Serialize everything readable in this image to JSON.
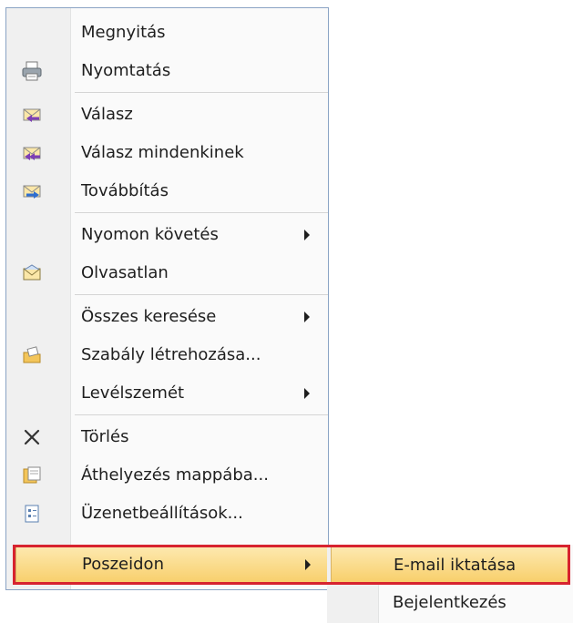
{
  "menu": {
    "items": [
      {
        "label": "Megnyitás",
        "icon": null,
        "arrow": false
      },
      {
        "label": "Nyomtatás",
        "icon": "printer-icon",
        "arrow": false
      },
      {
        "label": "Válasz",
        "icon": "reply-icon",
        "arrow": false
      },
      {
        "label": "Válasz mindenkinek",
        "icon": "reply-all-icon",
        "arrow": false
      },
      {
        "label": "Továbbítás",
        "icon": "forward-icon",
        "arrow": false
      },
      {
        "label": "Nyomon követés",
        "icon": null,
        "arrow": true
      },
      {
        "label": "Olvasatlan",
        "icon": "unread-envelope-icon",
        "arrow": false
      },
      {
        "label": "Összes keresése",
        "icon": null,
        "arrow": true
      },
      {
        "label": "Szabály létrehozása...",
        "icon": "rule-icon",
        "arrow": false
      },
      {
        "label": "Levélszemét",
        "icon": null,
        "arrow": true
      },
      {
        "label": "Törlés",
        "icon": "delete-icon",
        "arrow": false
      },
      {
        "label": "Áthelyezés mappába...",
        "icon": "move-to-folder-icon",
        "arrow": false
      },
      {
        "label": "Üzenetbeállítások...",
        "icon": "message-options-icon",
        "arrow": false
      },
      {
        "label": "Poszeidon",
        "icon": null,
        "arrow": true,
        "highlighted": true
      }
    ]
  },
  "submenu": {
    "items": [
      {
        "label": "E-mail iktatása",
        "highlighted": true
      },
      {
        "label": "Bejelentkezés",
        "highlighted": false
      }
    ]
  },
  "colors": {
    "highlight_top": "#fde9b0",
    "highlight_bottom": "#f8cf6b",
    "annotation_red": "#d7232f",
    "menu_border": "#8aa3c4"
  }
}
